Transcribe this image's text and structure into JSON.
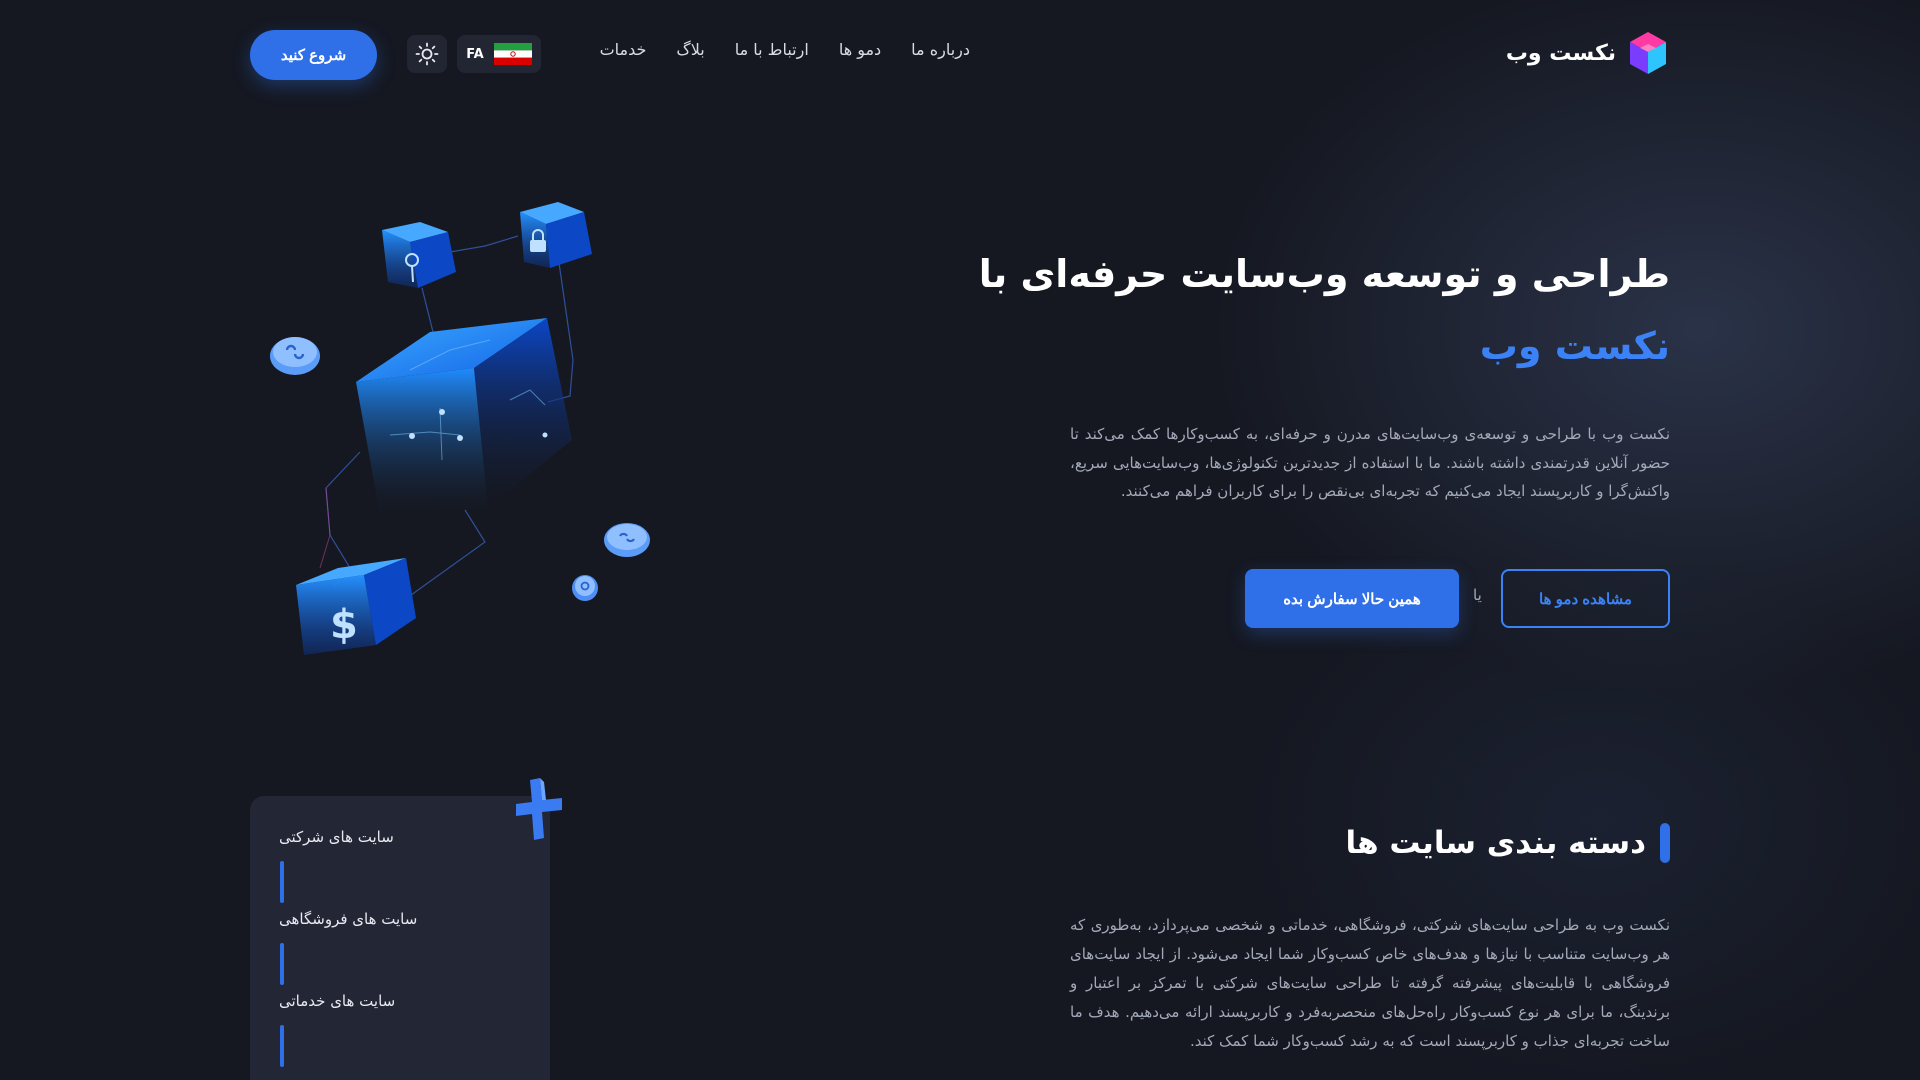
{
  "header": {
    "logo_text": "نکست وب",
    "nav": [
      "درباره ما",
      "دمو ها",
      "ارتباط با ما",
      "بلاگ",
      "خدمات"
    ],
    "lang_code": "FA",
    "start_label": "شروع کنید"
  },
  "hero": {
    "title": "طراحی و توسعه وب‌سایت حرفه‌ای با",
    "brand": "نکست وب",
    "description": "نکست وب با طراحی و توسعه‌ی وب‌سایت‌های مدرن و حرفه‌ای، به کسب‌وکارها کمک می‌کند تا حضور آنلاین قدرتمندی داشته باشند. ما با استفاده از جدیدترین تکنولوژی‌ها، وب‌سایت‌هایی سریع، واکنش‌گرا و کاربرپسند ایجاد می‌کنیم که تجربه‌ای بی‌نقص را برای کاربران فراهم می‌کنند.",
    "demos_label": "مشاهده دمو ها",
    "or_label": "یا",
    "order_label": "همین حالا سفارش بده"
  },
  "categories": {
    "title": "دسته بندی سایت ها",
    "description": "نکست وب به طراحی سایت‌های شرکتی، فروشگاهی، خدماتی و شخصی می‌پردازد، به‌طوری که هر وب‌سایت متناسب با نیازها و هدف‌های خاص کسب‌وکار شما ایجاد می‌شود. از ایجاد سایت‌های فروشگاهی با قابلیت‌های پیشرفته گرفته تا طراحی سایت‌های شرکتی با تمرکز بر اعتبار و برندینگ، ما برای هر نوع کسب‌وکار راه‌حل‌های منحصربه‌فرد و کاربرپسند ارائه می‌دهیم. هدف ما ساخت تجربه‌ای جذاب و کاربرپسند است که به رشد کسب‌وکار شما کمک کند.",
    "items": [
      "سایت های شرکتی",
      "سایت های فروشگاهی",
      "سایت های خدماتی"
    ]
  },
  "colors": {
    "background": "#151821",
    "accent": "#2f6fe8",
    "brand_text": "#3b82f6",
    "card": "#232735"
  },
  "icons": [
    "logo-cube-icon",
    "iran-flag-icon",
    "sun-icon",
    "key-icon",
    "lock-icon",
    "link-icon",
    "dollar-icon",
    "plus-icon"
  ]
}
